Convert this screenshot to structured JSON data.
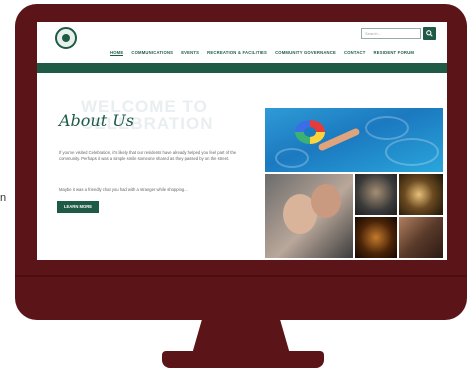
{
  "side_fragment": "n",
  "site": {
    "search": {
      "placeholder": "Search..."
    },
    "nav": [
      {
        "label": "HOME",
        "active": true
      },
      {
        "label": "COMMUNICATIONS",
        "active": false
      },
      {
        "label": "EVENTS",
        "active": false
      },
      {
        "label": "RECREATION & FACILITIES",
        "active": false
      },
      {
        "label": "COMMUNITY GOVERNANCE",
        "active": false
      },
      {
        "label": "CONTACT",
        "active": false
      },
      {
        "label": "RESIDENT FORUM",
        "active": false
      }
    ],
    "watermark_line1": "WELCOME TO",
    "watermark_line2": "CELEBRATION",
    "about_title": "About Us",
    "para1": "If you've visited Celebration, it's likely that our residents have already helped you feel part of the community. Perhaps it was a simple smile someone shared as they passed by on the street.",
    "para2": "Maybe it was a friendly chat you had with a stranger while shopping...",
    "learn_more": "LEARN MORE"
  },
  "colors": {
    "monitor": "#5b1417",
    "brand_green": "#1e5a46"
  }
}
